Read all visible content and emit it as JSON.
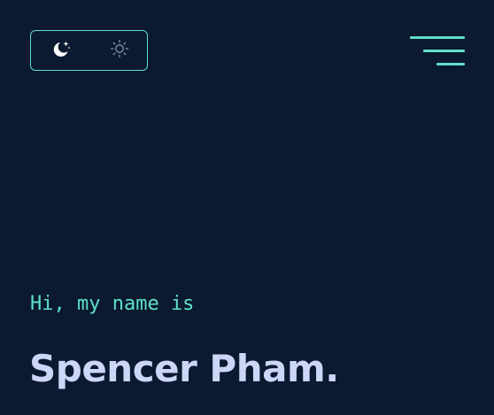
{
  "theme_toggle": {
    "options": [
      {
        "icon": "moon-stars-icon",
        "active": true
      },
      {
        "icon": "sun-icon",
        "active": false
      }
    ]
  },
  "menu": {
    "icon": "hamburger-menu-icon"
  },
  "hero": {
    "greeting": "Hi, my name is",
    "name": "Spencer Pham."
  },
  "colors": {
    "background": "#0b1a30",
    "accent": "#5ee0c9",
    "name_text": "#ccd6f6"
  }
}
